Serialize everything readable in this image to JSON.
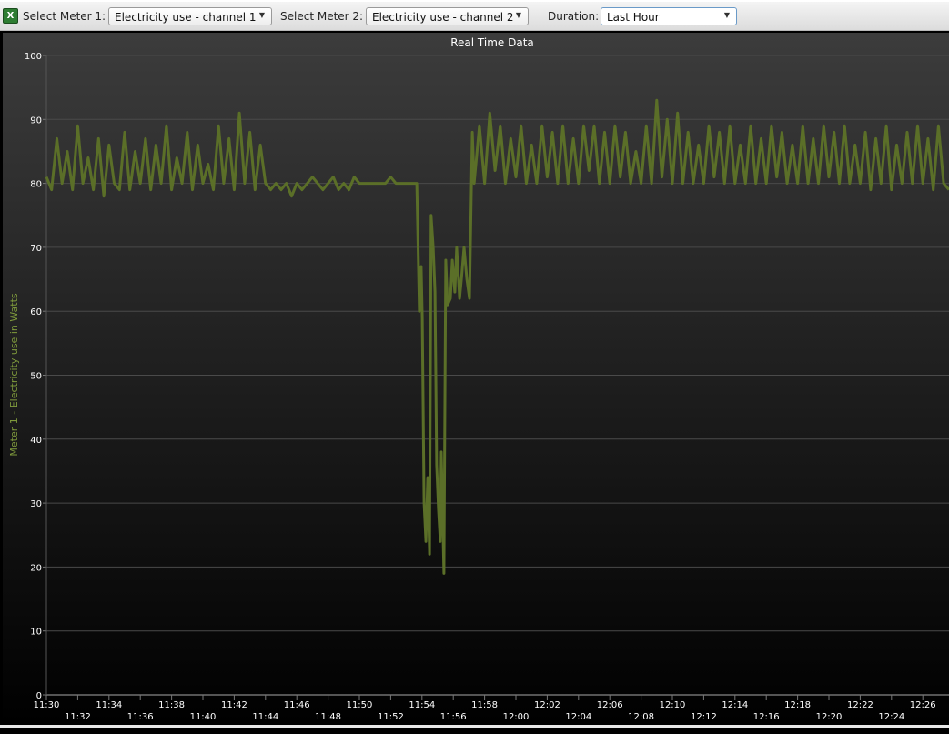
{
  "toolbar": {
    "export_icon": "excel-icon",
    "meter1_label": "Select Meter 1:",
    "meter1_value": "Electricity use - channel 1",
    "meter2_label": "Select Meter 2:",
    "meter2_value": "Electricity use - channel 2",
    "duration_label": "Duration:",
    "duration_value": "Last Hour"
  },
  "colors": {
    "line": "#5b6f28",
    "ylabel": "#7f9a3c",
    "grid": "#4a4a4a"
  },
  "chart_data": {
    "type": "line",
    "title": "Real Time Data",
    "xlabel": "",
    "ylabel": "Meter 1 - Electricity use in Watts",
    "ylim": [
      0,
      100
    ],
    "yticks": [
      0,
      10,
      20,
      30,
      40,
      50,
      60,
      70,
      80,
      90,
      100
    ],
    "xlim": [
      "11:30:00",
      "12:27:40"
    ],
    "xticks": [
      "11:30",
      "11:32",
      "11:34",
      "11:36",
      "11:38",
      "11:40",
      "11:42",
      "11:44",
      "11:46",
      "11:48",
      "11:50",
      "11:52",
      "11:54",
      "11:56",
      "11:58",
      "12:00",
      "12:02",
      "12:04",
      "12:06",
      "12:08",
      "12:10",
      "12:12",
      "12:14",
      "12:16",
      "12:18",
      "12:20",
      "12:22",
      "12:24",
      "12:26"
    ],
    "grid": true,
    "series": [
      {
        "points": [
          [
            "11:30:00",
            81
          ],
          [
            "11:30:20",
            79
          ],
          [
            "11:30:40",
            87
          ],
          [
            "11:31:00",
            80
          ],
          [
            "11:31:20",
            85
          ],
          [
            "11:31:40",
            79
          ],
          [
            "11:32:00",
            89
          ],
          [
            "11:32:20",
            80
          ],
          [
            "11:32:40",
            84
          ],
          [
            "11:33:00",
            79
          ],
          [
            "11:33:20",
            87
          ],
          [
            "11:33:40",
            78
          ],
          [
            "11:34:00",
            86
          ],
          [
            "11:34:20",
            80
          ],
          [
            "11:34:40",
            79
          ],
          [
            "11:35:00",
            88
          ],
          [
            "11:35:20",
            79
          ],
          [
            "11:35:40",
            85
          ],
          [
            "11:36:00",
            80
          ],
          [
            "11:36:20",
            87
          ],
          [
            "11:36:40",
            79
          ],
          [
            "11:37:00",
            86
          ],
          [
            "11:37:20",
            80
          ],
          [
            "11:37:40",
            89
          ],
          [
            "11:38:00",
            79
          ],
          [
            "11:38:20",
            84
          ],
          [
            "11:38:40",
            80
          ],
          [
            "11:39:00",
            88
          ],
          [
            "11:39:20",
            79
          ],
          [
            "11:39:40",
            86
          ],
          [
            "11:40:00",
            80
          ],
          [
            "11:40:20",
            83
          ],
          [
            "11:40:40",
            79
          ],
          [
            "11:41:00",
            89
          ],
          [
            "11:41:20",
            80
          ],
          [
            "11:41:40",
            87
          ],
          [
            "11:42:00",
            79
          ],
          [
            "11:42:20",
            91
          ],
          [
            "11:42:40",
            80
          ],
          [
            "11:43:00",
            88
          ],
          [
            "11:43:20",
            79
          ],
          [
            "11:43:40",
            86
          ],
          [
            "11:44:00",
            80
          ],
          [
            "11:44:20",
            79
          ],
          [
            "11:44:40",
            80
          ],
          [
            "11:45:00",
            79
          ],
          [
            "11:45:20",
            80
          ],
          [
            "11:45:40",
            78
          ],
          [
            "11:46:00",
            80
          ],
          [
            "11:46:20",
            79
          ],
          [
            "11:46:40",
            80
          ],
          [
            "11:47:00",
            81
          ],
          [
            "11:47:20",
            80
          ],
          [
            "11:47:40",
            79
          ],
          [
            "11:48:00",
            80
          ],
          [
            "11:48:20",
            81
          ],
          [
            "11:48:40",
            79
          ],
          [
            "11:49:00",
            80
          ],
          [
            "11:49:20",
            79
          ],
          [
            "11:49:40",
            81
          ],
          [
            "11:50:00",
            80
          ],
          [
            "11:50:20",
            80
          ],
          [
            "11:50:40",
            80
          ],
          [
            "11:51:00",
            80
          ],
          [
            "11:51:20",
            80
          ],
          [
            "11:51:40",
            80
          ],
          [
            "11:52:00",
            81
          ],
          [
            "11:52:20",
            80
          ],
          [
            "11:52:40",
            80
          ],
          [
            "11:53:00",
            80
          ],
          [
            "11:53:20",
            80
          ],
          [
            "11:53:40",
            80
          ],
          [
            "11:53:50",
            60
          ],
          [
            "11:53:57",
            67
          ],
          [
            "11:54:01",
            59
          ],
          [
            "11:54:08",
            30
          ],
          [
            "11:54:15",
            24
          ],
          [
            "11:54:22",
            34
          ],
          [
            "11:54:29",
            22
          ],
          [
            "11:54:35",
            75
          ],
          [
            "11:54:43",
            70
          ],
          [
            "11:54:50",
            63
          ],
          [
            "11:54:56",
            36
          ],
          [
            "11:55:03",
            29
          ],
          [
            "11:55:10",
            24
          ],
          [
            "11:55:14",
            38
          ],
          [
            "11:55:24",
            19
          ],
          [
            "11:55:31",
            68
          ],
          [
            "11:55:38",
            61
          ],
          [
            "11:55:49",
            62
          ],
          [
            "11:55:56",
            68
          ],
          [
            "11:56:06",
            63
          ],
          [
            "11:56:13",
            70
          ],
          [
            "11:56:24",
            62
          ],
          [
            "11:56:31",
            65
          ],
          [
            "11:56:41",
            70
          ],
          [
            "11:56:52",
            65
          ],
          [
            "11:57:02",
            62
          ],
          [
            "11:57:13",
            88
          ],
          [
            "11:57:20",
            80
          ],
          [
            "11:57:40",
            89
          ],
          [
            "11:58:00",
            80
          ],
          [
            "11:58:20",
            91
          ],
          [
            "11:58:40",
            82
          ],
          [
            "11:59:00",
            89
          ],
          [
            "11:59:20",
            80
          ],
          [
            "11:59:40",
            87
          ],
          [
            "12:00:00",
            81
          ],
          [
            "12:00:20",
            89
          ],
          [
            "12:00:40",
            80
          ],
          [
            "12:01:00",
            86
          ],
          [
            "12:01:20",
            80
          ],
          [
            "12:01:40",
            89
          ],
          [
            "12:02:00",
            81
          ],
          [
            "12:02:20",
            88
          ],
          [
            "12:02:40",
            80
          ],
          [
            "12:03:00",
            89
          ],
          [
            "12:03:20",
            80
          ],
          [
            "12:03:40",
            87
          ],
          [
            "12:04:00",
            80
          ],
          [
            "12:04:20",
            89
          ],
          [
            "12:04:40",
            82
          ],
          [
            "12:05:00",
            89
          ],
          [
            "12:05:20",
            80
          ],
          [
            "12:05:40",
            88
          ],
          [
            "12:06:00",
            80
          ],
          [
            "12:06:20",
            89
          ],
          [
            "12:06:40",
            81
          ],
          [
            "12:07:00",
            88
          ],
          [
            "12:07:20",
            80
          ],
          [
            "12:07:40",
            85
          ],
          [
            "12:08:00",
            80
          ],
          [
            "12:08:20",
            89
          ],
          [
            "12:08:40",
            80
          ],
          [
            "12:09:00",
            93
          ],
          [
            "12:09:20",
            81
          ],
          [
            "12:09:40",
            90
          ],
          [
            "12:10:00",
            80
          ],
          [
            "12:10:20",
            91
          ],
          [
            "12:10:40",
            80
          ],
          [
            "12:11:00",
            88
          ],
          [
            "12:11:20",
            80
          ],
          [
            "12:11:40",
            86
          ],
          [
            "12:12:00",
            80
          ],
          [
            "12:12:20",
            89
          ],
          [
            "12:12:40",
            81
          ],
          [
            "12:13:00",
            88
          ],
          [
            "12:13:20",
            80
          ],
          [
            "12:13:40",
            89
          ],
          [
            "12:14:00",
            80
          ],
          [
            "12:14:20",
            86
          ],
          [
            "12:14:40",
            80
          ],
          [
            "12:15:00",
            89
          ],
          [
            "12:15:20",
            80
          ],
          [
            "12:15:40",
            87
          ],
          [
            "12:16:00",
            80
          ],
          [
            "12:16:20",
            89
          ],
          [
            "12:16:40",
            81
          ],
          [
            "12:17:00",
            88
          ],
          [
            "12:17:20",
            80
          ],
          [
            "12:17:40",
            86
          ],
          [
            "12:18:00",
            80
          ],
          [
            "12:18:20",
            89
          ],
          [
            "12:18:40",
            80
          ],
          [
            "12:19:00",
            87
          ],
          [
            "12:19:20",
            80
          ],
          [
            "12:19:40",
            89
          ],
          [
            "12:20:00",
            81
          ],
          [
            "12:20:20",
            88
          ],
          [
            "12:20:40",
            80
          ],
          [
            "12:21:00",
            89
          ],
          [
            "12:21:20",
            80
          ],
          [
            "12:21:40",
            86
          ],
          [
            "12:22:00",
            80
          ],
          [
            "12:22:20",
            88
          ],
          [
            "12:22:40",
            79
          ],
          [
            "12:23:00",
            87
          ],
          [
            "12:23:20",
            80
          ],
          [
            "12:23:40",
            89
          ],
          [
            "12:24:00",
            79
          ],
          [
            "12:24:20",
            86
          ],
          [
            "12:24:40",
            80
          ],
          [
            "12:25:00",
            88
          ],
          [
            "12:25:20",
            80
          ],
          [
            "12:25:40",
            89
          ],
          [
            "12:26:00",
            80
          ],
          [
            "12:26:20",
            87
          ],
          [
            "12:26:40",
            79
          ],
          [
            "12:27:00",
            89
          ],
          [
            "12:27:20",
            80
          ],
          [
            "12:27:40",
            79
          ]
        ]
      }
    ]
  }
}
